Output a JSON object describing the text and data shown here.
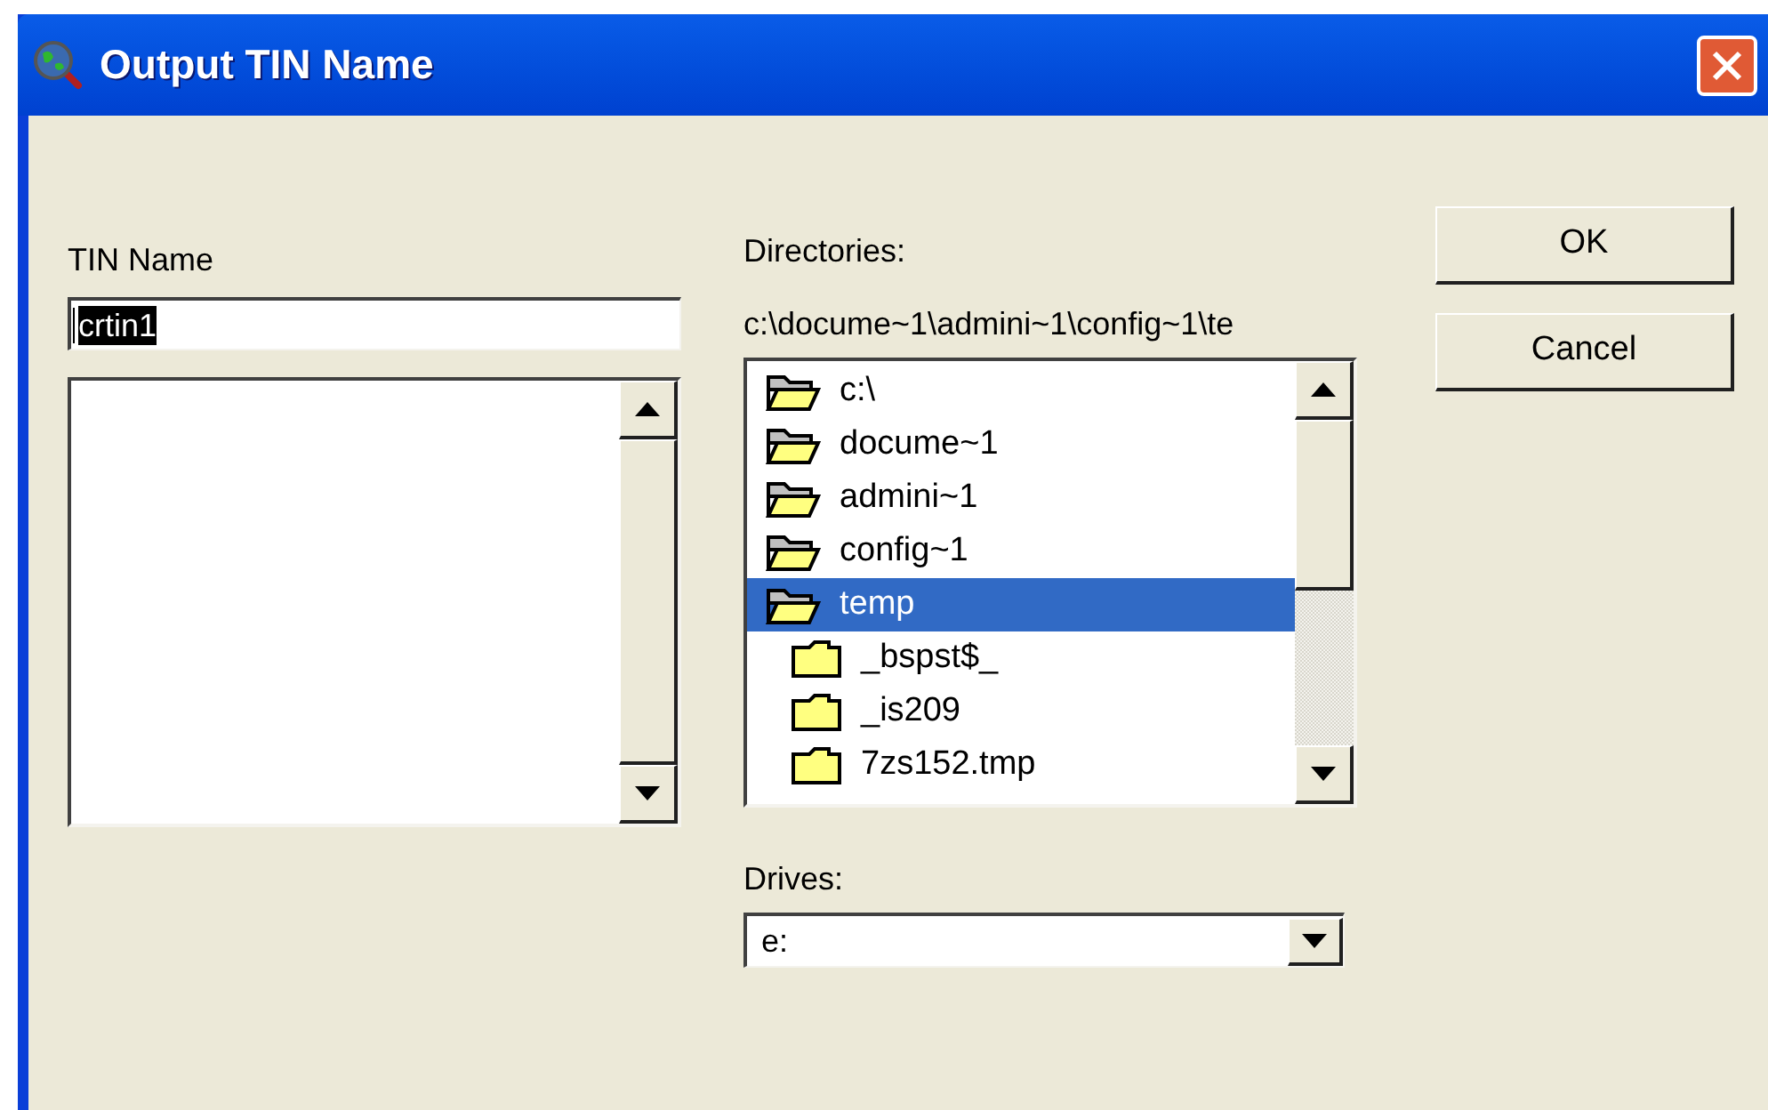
{
  "window": {
    "title": "Output TIN Name"
  },
  "tin_name": {
    "label": "TIN Name",
    "value": "crtin1",
    "selected": true
  },
  "directories": {
    "label": "Directories:",
    "path": "c:\\docume~1\\admini~1\\config~1\\te",
    "items": [
      {
        "name": "c:\\",
        "kind": "open",
        "selected": false
      },
      {
        "name": "docume~1",
        "kind": "open",
        "selected": false
      },
      {
        "name": "admini~1",
        "kind": "open",
        "selected": false
      },
      {
        "name": "config~1",
        "kind": "open",
        "selected": false
      },
      {
        "name": "temp",
        "kind": "open",
        "selected": true,
        "children": [
          {
            "name": "_bspst$_",
            "kind": "closed",
            "selected": false
          },
          {
            "name": "_is209",
            "kind": "closed",
            "selected": false
          },
          {
            "name": "7zs152.tmp",
            "kind": "closed",
            "selected": false
          }
        ]
      }
    ]
  },
  "drives": {
    "label": "Drives:",
    "value": "e:"
  },
  "buttons": [
    {
      "label": "OK"
    },
    {
      "label": "Cancel"
    }
  ]
}
